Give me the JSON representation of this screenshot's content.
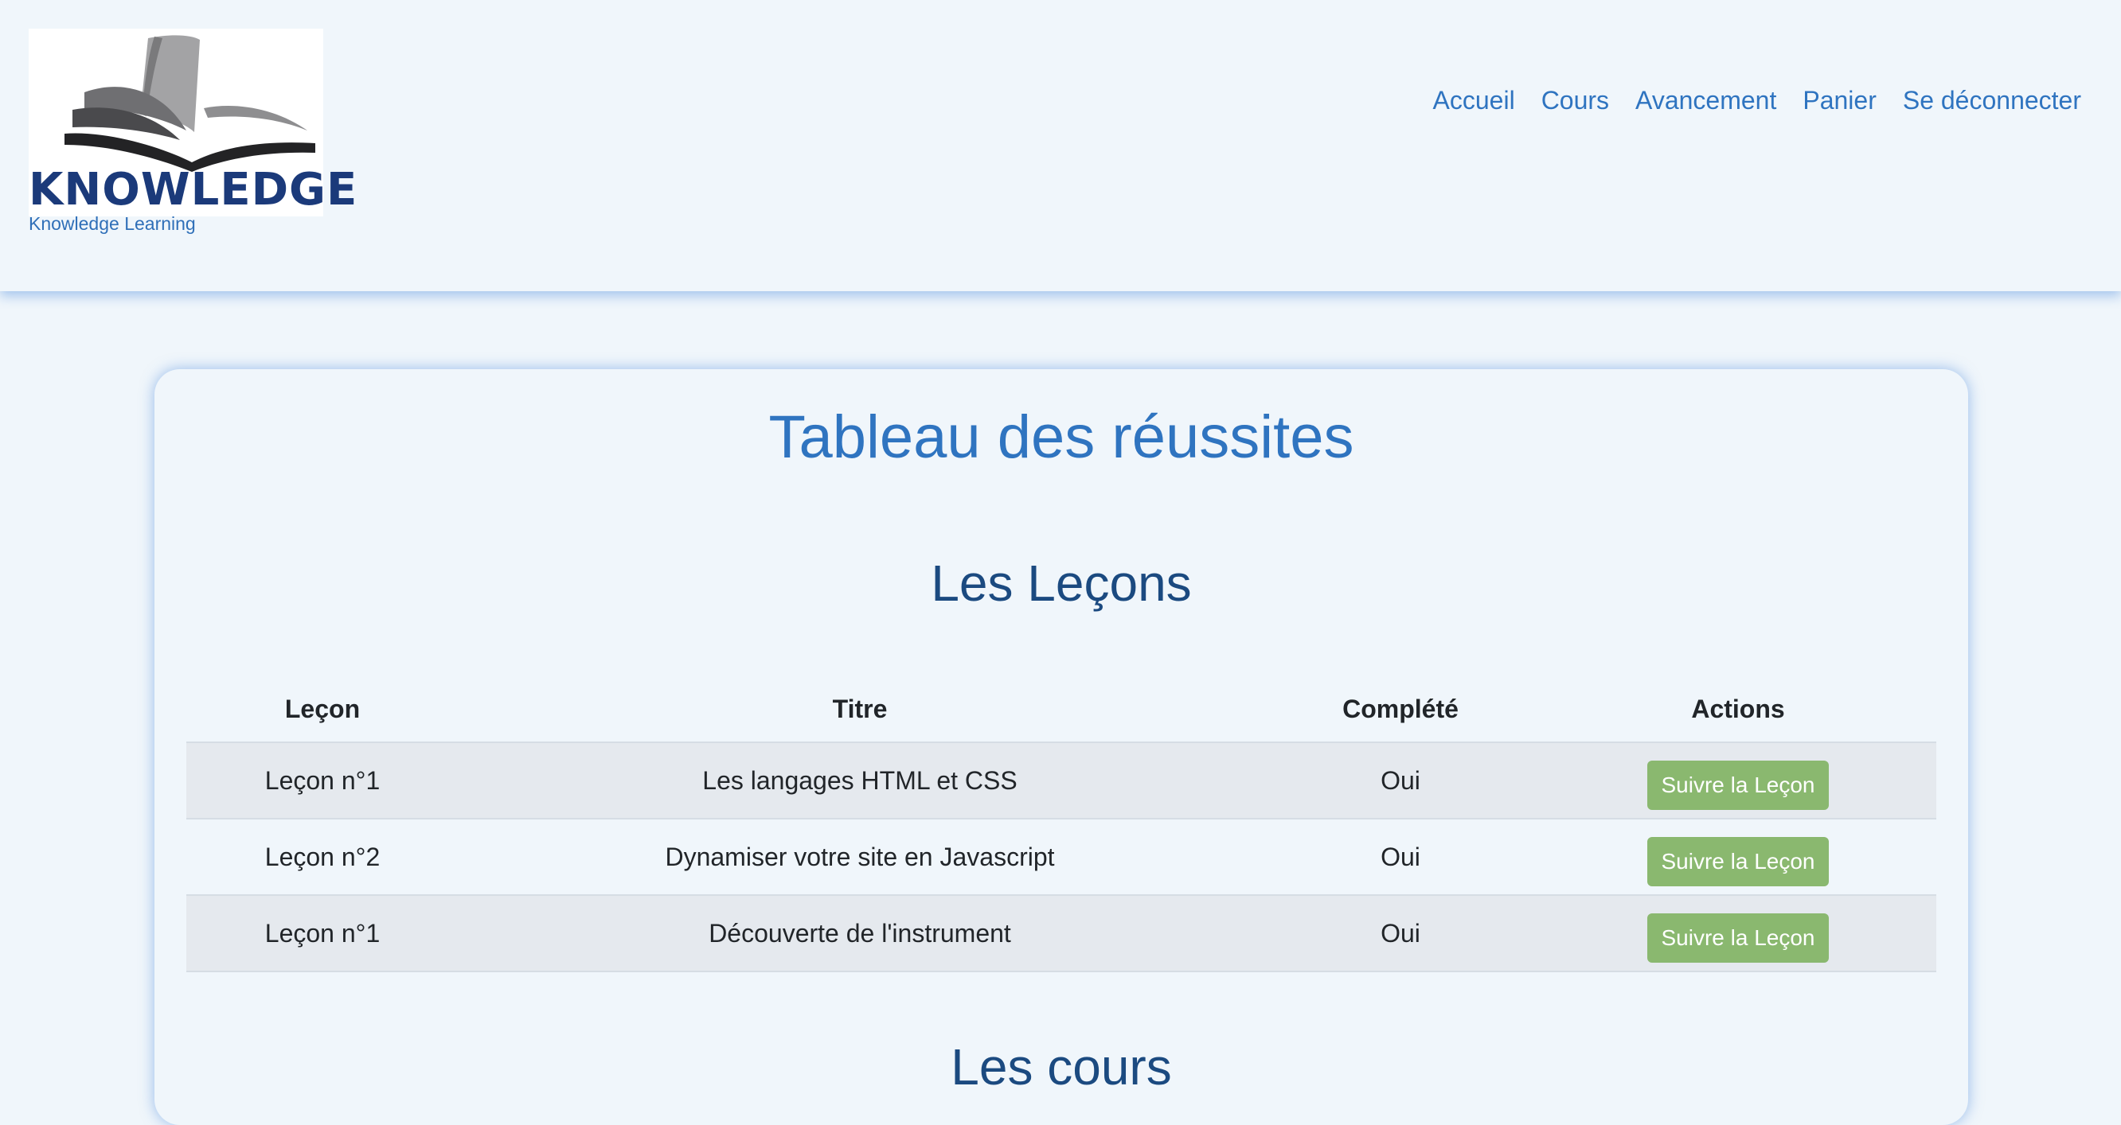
{
  "header": {
    "logo_text": "KNOWLEDGE",
    "logo_subtitle": "Knowledge Learning",
    "nav": [
      {
        "label": "Accueil"
      },
      {
        "label": "Cours"
      },
      {
        "label": "Avancement"
      },
      {
        "label": "Panier"
      },
      {
        "label": "Se déconnecter"
      }
    ]
  },
  "main": {
    "page_title": "Tableau des réussites",
    "lessons_section": {
      "title": "Les Leçons",
      "columns": [
        "Leçon",
        "Titre",
        "Complété",
        "Actions"
      ],
      "rows": [
        {
          "lecon": "Leçon n°1",
          "titre": "Les langages HTML et CSS",
          "complete": "Oui",
          "action": "Suivre la Leçon"
        },
        {
          "lecon": "Leçon n°2",
          "titre": "Dynamiser votre site en Javascript",
          "complete": "Oui",
          "action": "Suivre la Leçon"
        },
        {
          "lecon": "Leçon n°1",
          "titre": "Découverte de l'instrument",
          "complete": "Oui",
          "action": "Suivre la Leçon"
        }
      ]
    },
    "courses_section": {
      "title": "Les cours"
    }
  },
  "colors": {
    "accent": "#2f74c0",
    "section_heading": "#1b4a80",
    "button_green": "#8ab86f",
    "background": "#f0f6fb",
    "logo_navy": "#1b3a7a"
  },
  "icons": {
    "logo": "open-book-icon"
  }
}
